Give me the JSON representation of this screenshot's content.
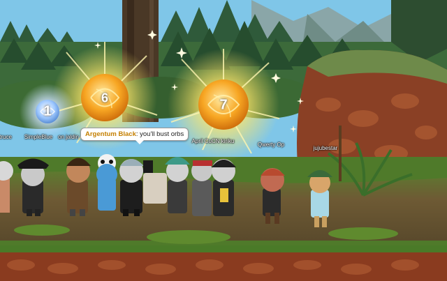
{
  "orbs": [
    {
      "number": "1",
      "color": "#9ec8ff"
    },
    {
      "number": "6",
      "color": "#f7a623"
    },
    {
      "number": "7",
      "color": "#f7a623"
    }
  ],
  "chat_bubble": {
    "speaker": "Argentum Black",
    "message": ": you'll bust orbs"
  },
  "player_names": {
    "truce": "truce",
    "simple": "SimpleBlue",
    "jaldin": "on jaldin",
    "april": "April CuCN kiriku",
    "qwerty": "Qwerty Op",
    "juju": "jujubestar"
  },
  "colors": {
    "sky": "#7fc6e8",
    "grass": "#4f7a2a",
    "dirt_path": "#6e5a34",
    "dirt_border": "#8a3b1f",
    "orb_glow": "#fff3a0"
  }
}
